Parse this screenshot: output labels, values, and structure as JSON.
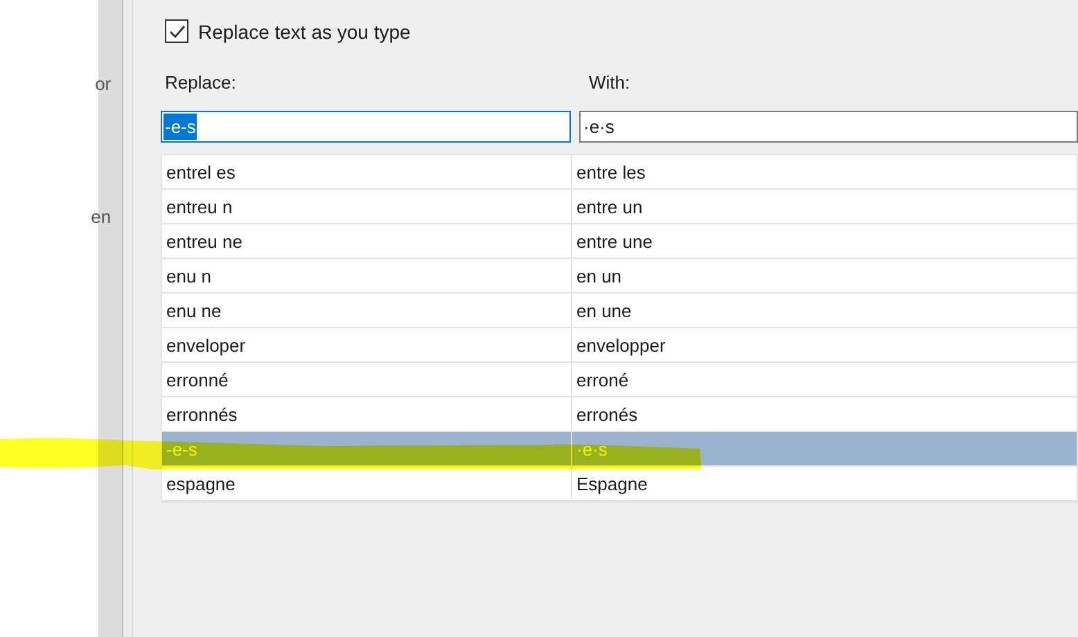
{
  "side_fragments": [
    "or",
    "en"
  ],
  "replace_as_you_type": {
    "label": "Replace text as you type",
    "checked": true
  },
  "columns": [
    "Replace:",
    "With:"
  ],
  "inputs": {
    "replace": {
      "value": "-e-s",
      "selected_text": true
    },
    "with": {
      "value": "·e·s"
    }
  },
  "rows": [
    {
      "replace": "entrel es",
      "with": "entre les",
      "selected": false
    },
    {
      "replace": "entreu n",
      "with": "entre un",
      "selected": false
    },
    {
      "replace": "entreu ne",
      "with": "entre une",
      "selected": false
    },
    {
      "replace": "enu n",
      "with": "en un",
      "selected": false
    },
    {
      "replace": "enu ne",
      "with": "en une",
      "selected": false
    },
    {
      "replace": "enveloper",
      "with": "envelopper",
      "selected": false
    },
    {
      "replace": "erronné",
      "with": "erroné",
      "selected": false
    },
    {
      "replace": "erronnés",
      "with": "erronés",
      "selected": false
    },
    {
      "replace": "-e-s",
      "with": "·e·s",
      "selected": true
    },
    {
      "replace": "espagne",
      "with": "Espagne",
      "selected": false
    }
  ]
}
